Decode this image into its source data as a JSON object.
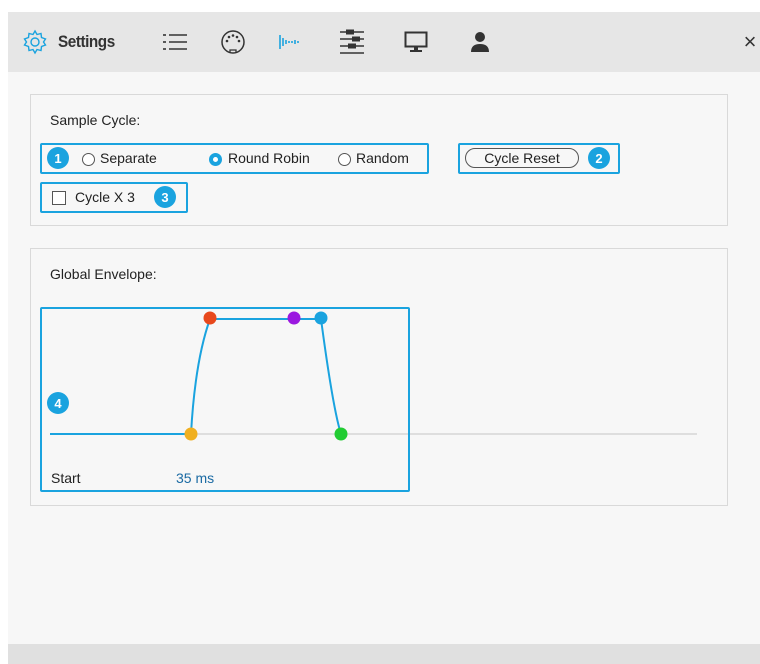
{
  "toolbar": {
    "title": "Settings",
    "icons": [
      "gear-icon",
      "list-icon",
      "midi-icon",
      "waveform-icon",
      "sliders-icon",
      "monitor-icon",
      "user-icon"
    ],
    "close": "×"
  },
  "sample_cycle": {
    "title": "Sample Cycle:",
    "options": [
      "Separate",
      "Round Robin",
      "Random"
    ],
    "selected": "Round Robin",
    "reset_label": "Cycle Reset",
    "checkbox_label": "Cycle X 3",
    "checkbox_checked": false
  },
  "envelope": {
    "title": "Global Envelope:",
    "param_label": "Start",
    "param_value": "35 ms"
  },
  "badges": [
    "1",
    "2",
    "3",
    "4"
  ],
  "colors": {
    "accent": "#1aa3df",
    "value_text": "#1a6aa3",
    "point_start": "#f0b020",
    "point_attack": "#e8481c",
    "point_hold": "#9b18e0",
    "point_decay": "#1aa3df",
    "point_release": "#22cc33"
  }
}
